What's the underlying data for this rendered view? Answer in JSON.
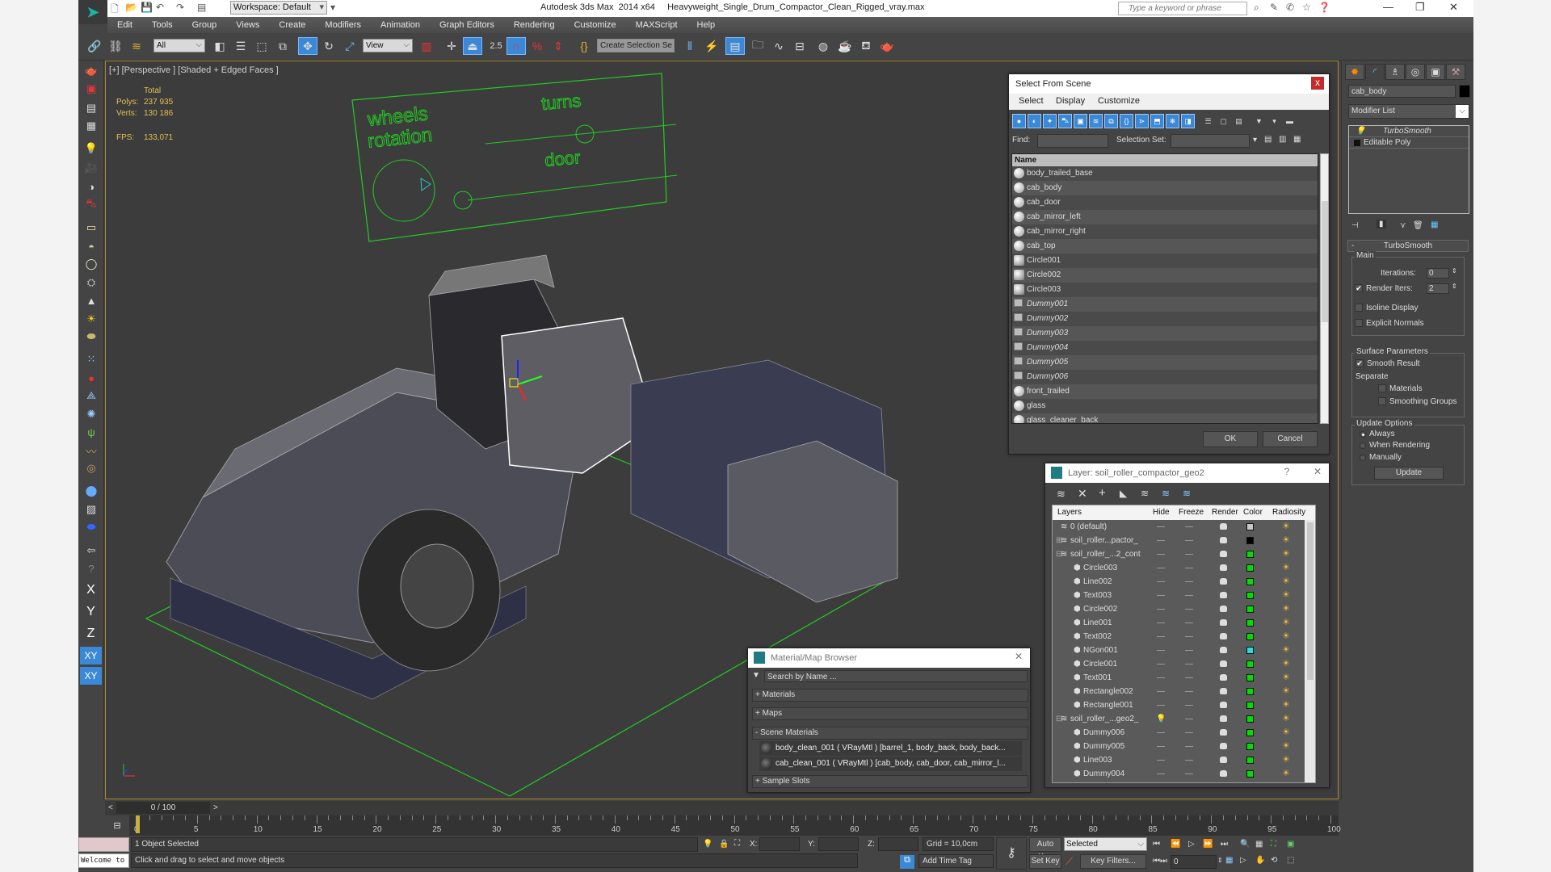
{
  "titlebar": {
    "workspace": "Workspace: Default",
    "app_title": "Autodesk 3ds Max  2014 x64     Heavyweight_Single_Drum_Compactor_Clean_Rigged_vray.max",
    "search_placeholder": "Type a keyword or phrase"
  },
  "menu": [
    "Edit",
    "Tools",
    "Group",
    "Views",
    "Create",
    "Modifiers",
    "Animation",
    "Graph Editors",
    "Rendering",
    "Customize",
    "MAXScript",
    "Help"
  ],
  "toolbar": {
    "selection_filter": "All",
    "ref_coord": "View",
    "snap_angle": "2.5",
    "named_selection_placeholder": "Create Selection Se"
  },
  "viewport": {
    "label": "[+] [Perspective ] [Shaded + Edged Faces ]",
    "stats": {
      "header": "Total",
      "polys_label": "Polys:",
      "polys": "237 935",
      "verts_label": "Verts:",
      "verts": "130 186",
      "fps_label": "FPS:",
      "fps": "133,071"
    },
    "annotations": {
      "wheels": "wheels",
      "rotation": "rotation",
      "turns": "turns",
      "door": "door"
    },
    "colors": {
      "rig_green": "#22cc22",
      "border_gold": "#a98a2a"
    }
  },
  "left_toolbar": {
    "axes": [
      "X",
      "Y",
      "Z",
      "XY",
      "XY"
    ]
  },
  "command_panel": {
    "object_name": "cab_body",
    "modifier_list": "Modifier List",
    "stack": [
      "TurboSmooth",
      "Editable Poly"
    ],
    "rollout": "TurboSmooth",
    "main_group": "Main",
    "iterations_label": "Iterations:",
    "iterations": "0",
    "render_iters_label": "Render Iters:",
    "render_iters": "2",
    "render_iters_checked": true,
    "isoline_label": "Isoline Display",
    "explicit_normals_label": "Explicit Normals",
    "surface_group": "Surface Parameters",
    "smooth_result_label": "Smooth Result",
    "separate_label": "Separate",
    "materials_label": "Materials",
    "smoothing_groups_label": "Smoothing Groups",
    "update_group": "Update Options",
    "update_options": [
      "Always",
      "When Rendering",
      "Manually"
    ],
    "update_selected": "Always",
    "update_button": "Update"
  },
  "select_from_scene": {
    "title": "Select From Scene",
    "close": "x",
    "menu": [
      "Select",
      "Display",
      "Customize"
    ],
    "find_label": "Find:",
    "find_value": "",
    "selection_set_label": "Selection Set:",
    "column": "Name",
    "items": [
      {
        "name": "body_trailed_base",
        "type": "geometry"
      },
      {
        "name": "cab_body",
        "type": "geometry"
      },
      {
        "name": "cab_door",
        "type": "geometry"
      },
      {
        "name": "cab_mirror_left",
        "type": "geometry"
      },
      {
        "name": "cab_mirror_right",
        "type": "geometry"
      },
      {
        "name": "cab_top",
        "type": "geometry"
      },
      {
        "name": "Circle001",
        "type": "shape"
      },
      {
        "name": "Circle002",
        "type": "shape"
      },
      {
        "name": "Circle003",
        "type": "shape"
      },
      {
        "name": "Dummy001",
        "type": "helper"
      },
      {
        "name": "Dummy002",
        "type": "helper"
      },
      {
        "name": "Dummy003",
        "type": "helper"
      },
      {
        "name": "Dummy004",
        "type": "helper"
      },
      {
        "name": "Dummy005",
        "type": "helper"
      },
      {
        "name": "Dummy006",
        "type": "helper"
      },
      {
        "name": "front_trailed",
        "type": "geometry"
      },
      {
        "name": "glass",
        "type": "geometry"
      },
      {
        "name": "glass_cleaner_back",
        "type": "geometry"
      }
    ],
    "ok": "OK",
    "cancel": "Cancel"
  },
  "layer_dialog": {
    "title": "Layer: soil_roller_compactor_geo2",
    "help": "?",
    "columns": [
      "Layers",
      "Hide",
      "Freeze",
      "Render",
      "Color",
      "Radiosity"
    ],
    "rows": [
      {
        "name": "0 (default)",
        "kind": "layer",
        "indent": 0,
        "color": "#c8c8c8",
        "expander": ""
      },
      {
        "name": "soil_roller...pactor_",
        "kind": "layer",
        "indent": 0,
        "color": "#000000",
        "expander": "+"
      },
      {
        "name": "soil_roller_...2_cont",
        "kind": "layer",
        "indent": 0,
        "color": "#00dd00",
        "expander": "-"
      },
      {
        "name": "Circle003",
        "kind": "object",
        "indent": 1,
        "color": "#00dd00"
      },
      {
        "name": "Line002",
        "kind": "object",
        "indent": 1,
        "color": "#00dd00"
      },
      {
        "name": "Text003",
        "kind": "object",
        "indent": 1,
        "color": "#00dd00"
      },
      {
        "name": "Circle002",
        "kind": "object",
        "indent": 1,
        "color": "#00dd00"
      },
      {
        "name": "Line001",
        "kind": "object",
        "indent": 1,
        "color": "#00dd00"
      },
      {
        "name": "Text002",
        "kind": "object",
        "indent": 1,
        "color": "#00dd00"
      },
      {
        "name": "NGon001",
        "kind": "object",
        "indent": 1,
        "color": "#22dddd"
      },
      {
        "name": "Circle001",
        "kind": "object",
        "indent": 1,
        "color": "#00dd00"
      },
      {
        "name": "Text001",
        "kind": "object",
        "indent": 1,
        "color": "#00dd00"
      },
      {
        "name": "Rectangle002",
        "kind": "object",
        "indent": 1,
        "color": "#00dd00"
      },
      {
        "name": "Rectangle001",
        "kind": "object",
        "indent": 1,
        "color": "#00dd00"
      },
      {
        "name": "soil_roller_...geo2_",
        "kind": "layer",
        "indent": 0,
        "color": "#00dd00",
        "expander": "-",
        "current": true
      },
      {
        "name": "Dummy006",
        "kind": "object",
        "indent": 1,
        "color": "#00dd00"
      },
      {
        "name": "Dummy005",
        "kind": "object",
        "indent": 1,
        "color": "#00dd00"
      },
      {
        "name": "Line003",
        "kind": "object",
        "indent": 1,
        "color": "#00dd00"
      },
      {
        "name": "Dummy004",
        "kind": "object",
        "indent": 1,
        "color": "#00dd00"
      }
    ]
  },
  "material_browser": {
    "title": "Material/Map Browser",
    "search_placeholder": "Search by Name ...",
    "sections": {
      "materials": "+ Materials",
      "maps": "+ Maps",
      "scene": "- Scene Materials",
      "samples": "+ Sample Slots"
    },
    "scene_materials": [
      "body_clean_001  ( VRayMtl ) [barrel_1, body_back, body_back...",
      "cab_clean_001  ( VRayMtl ) [cab_body, cab_door, cab_mirror_l..."
    ]
  },
  "timeline": {
    "frame_display": "0 / 100",
    "ticks": [
      0,
      5,
      10,
      15,
      20,
      25,
      30,
      35,
      40,
      45,
      50,
      55,
      60,
      65,
      70,
      75,
      80,
      85,
      90,
      95,
      100
    ],
    "current_frame": 0
  },
  "status": {
    "listener": "Welcome to M",
    "selection": "1 Object Selected",
    "prompt": "Click and drag to select and move objects",
    "x_label": "X:",
    "y_label": "Y:",
    "z_label": "Z:",
    "grid": "Grid = 10,0cm",
    "add_time_tag": "Add Time Tag",
    "auto_key": "Auto Key",
    "set_key": "Set Key",
    "key_mode": "Selected",
    "key_filters": "Key Filters...",
    "frame": "0"
  }
}
